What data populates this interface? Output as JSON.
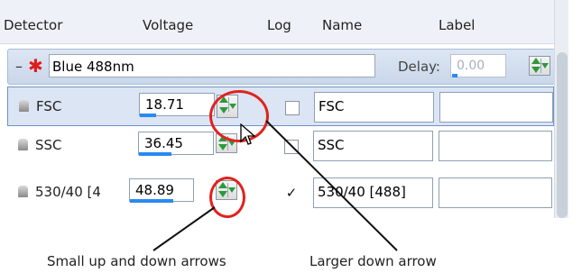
{
  "columns": [
    "Detector",
    "Voltage",
    "Log",
    "Name",
    "Label"
  ],
  "laser_group": {
    "name": "Blue 488nm",
    "delay_label": "Delay:",
    "delay_value": "0.00"
  },
  "rows": [
    {
      "detector": "FSC",
      "voltage": "18.71",
      "voltage_fraction": 0.15,
      "log": false,
      "log_mark": "",
      "name": "FSC",
      "label": ""
    },
    {
      "detector": "SSC",
      "voltage": "36.45",
      "voltage_fraction": 0.3,
      "log": false,
      "log_mark": "",
      "name": "SSC",
      "label": ""
    },
    {
      "detector": "530/40 [4",
      "voltage": "48.89",
      "voltage_fraction": 0.4,
      "log": true,
      "log_mark": "✓",
      "name": "530/40 [488]",
      "label": ""
    }
  ],
  "annotations": {
    "small_arrows": "Small up and down arrows",
    "larger_arrow": "Larger down arrow"
  },
  "colors": {
    "highlight": "#e0221d",
    "progress": "#2a8af0",
    "spin_arrow": "#2b9a3a",
    "selected_row": "#dbe5f4"
  },
  "icons": [
    "laser-star-icon",
    "detector-icon",
    "spin-up-icon",
    "spin-down-icon",
    "large-down-arrow-icon",
    "mouse-cursor-icon"
  ]
}
